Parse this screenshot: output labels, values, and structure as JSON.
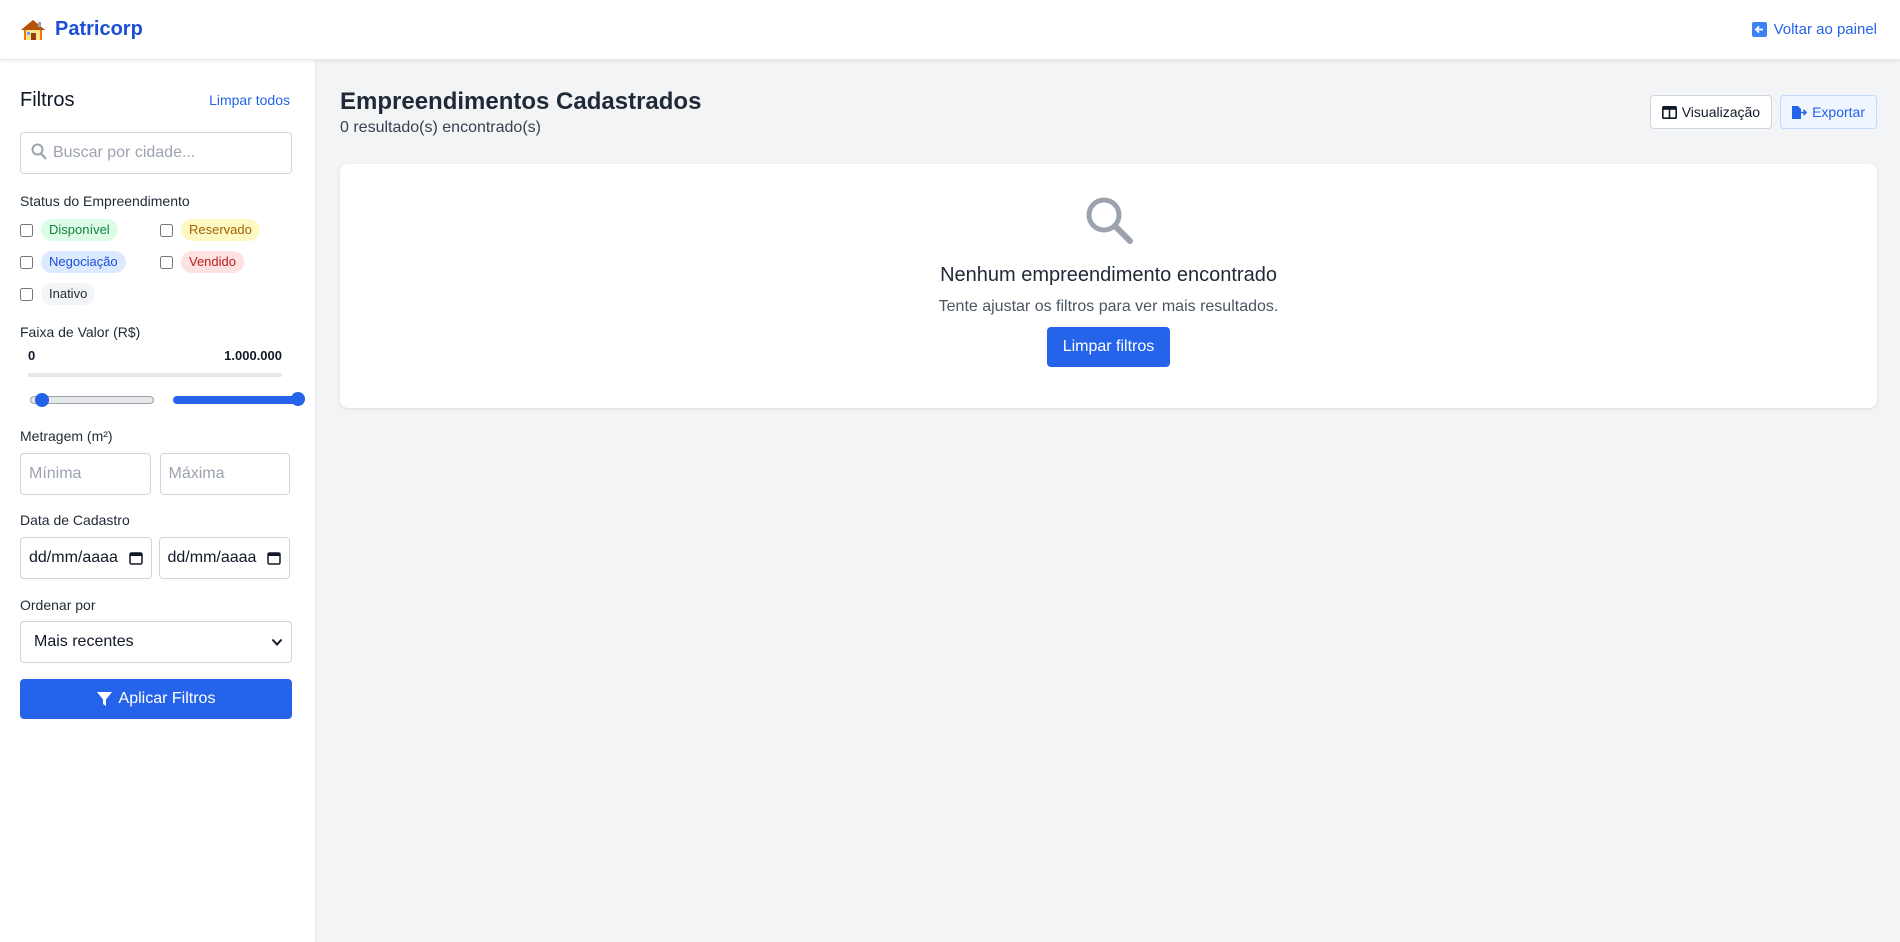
{
  "header": {
    "brand_icon": "house-icon",
    "brand_name": "Patricorp",
    "back_icon": "arrow-left-box-icon",
    "back_label": "Voltar ao painel"
  },
  "sidebar": {
    "title": "Filtros",
    "clear_all": "Limpar todos",
    "search": {
      "placeholder": "Buscar por cidade...",
      "value": "",
      "icon": "search-icon"
    },
    "status": {
      "label": "Status do Empreendimento",
      "options": [
        {
          "label": "Disponível",
          "checked": false,
          "bg": "#dcfce7",
          "fg": "#15803d"
        },
        {
          "label": "Reservado",
          "checked": false,
          "bg": "#fef9c3",
          "fg": "#a16207"
        },
        {
          "label": "Negociação",
          "checked": false,
          "bg": "#dbeafe",
          "fg": "#1d4ed8"
        },
        {
          "label": "Vendido",
          "checked": false,
          "bg": "#fee2e2",
          "fg": "#b91c1c"
        },
        {
          "label": "Inativo",
          "checked": false,
          "bg": "#f3f4f6",
          "fg": "#1f2937"
        }
      ]
    },
    "price": {
      "label": "Faixa de Valor (R$)",
      "min_display": "0",
      "max_display": "1.000.000",
      "slider_min_fraction": 0.0,
      "slider_max_fraction": 1.0
    },
    "area": {
      "label": "Metragem (m²)",
      "min_placeholder": "Mínima",
      "max_placeholder": "Máxima"
    },
    "date": {
      "label": "Data de Cadastro",
      "from_value": "dd/mm/aaaa",
      "to_value": "dd/mm/aaaa",
      "icon": "calendar-icon"
    },
    "sort": {
      "label": "Ordenar por",
      "selected": "Mais recentes",
      "icon": "chevron-down-icon"
    },
    "apply_button": {
      "label": "Aplicar Filtros",
      "icon": "filter-icon"
    }
  },
  "main": {
    "title": "Empreendimentos Cadastrados",
    "subtitle": "0 resultado(s) encontrado(s)",
    "view_button": {
      "label": "Visualização",
      "icon": "table-columns-icon"
    },
    "export_button": {
      "label": "Exportar",
      "icon": "file-export-icon"
    },
    "empty_state": {
      "icon": "search-icon",
      "title": "Nenhum empreendimento encontrado",
      "text": "Tente ajustar os filtros para ver mais resultados.",
      "button": "Limpar filtros"
    }
  },
  "colors": {
    "accent": "#2563eb",
    "brand": "#1d4ed8",
    "page_bg": "#f3f4f6"
  }
}
